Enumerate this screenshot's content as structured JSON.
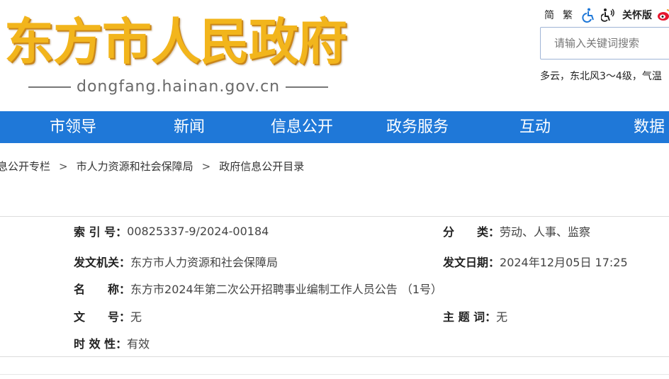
{
  "header": {
    "logo_title": "东方市人民政府",
    "logo_domain": "dongfang.hainan.gov.cn",
    "tools": {
      "simplified": "简",
      "traditional": "繁",
      "accessibility_icon": "wheelchair-icon",
      "elderly_icon": "accessibility-speaker-icon",
      "care_label": "关怀版",
      "weibo_icon": "weibo-icon"
    },
    "search_placeholder": "请输入关键词搜索",
    "weather": "多云，东北风3～4级，气温"
  },
  "nav": {
    "items": [
      {
        "label": "市领导"
      },
      {
        "label": "新闻"
      },
      {
        "label": "信息公开"
      },
      {
        "label": "政务服务"
      },
      {
        "label": "互动"
      },
      {
        "label": "数据"
      }
    ]
  },
  "breadcrumb": {
    "items": [
      "息公开专栏",
      "市人力资源和社会保障局",
      "政府信息公开目录"
    ],
    "separator": ">"
  },
  "info": {
    "index_label": "索 引 号：",
    "index_value": "00825337-9/2024-00184",
    "category_label": "分　　类：",
    "category_value": "劳动、人事、监察",
    "issuer_label": "发文机关：",
    "issuer_value": "东方市人力资源和社会保障局",
    "date_label": "发文日期：",
    "date_value": "2024年12月05日 17:25",
    "name_label": "名　　称：",
    "name_value": "东方市2024年第二次公开招聘事业编制工作人员公告 （1号）",
    "docno_label": "文　　号：",
    "docno_value": "无",
    "subject_label": "主 题 词：",
    "subject_value": "无",
    "validity_label": "时 效 性：",
    "validity_value": "有效"
  },
  "colors": {
    "nav_bg": "#1f78d8",
    "logo_gold": "#f2b51c"
  }
}
